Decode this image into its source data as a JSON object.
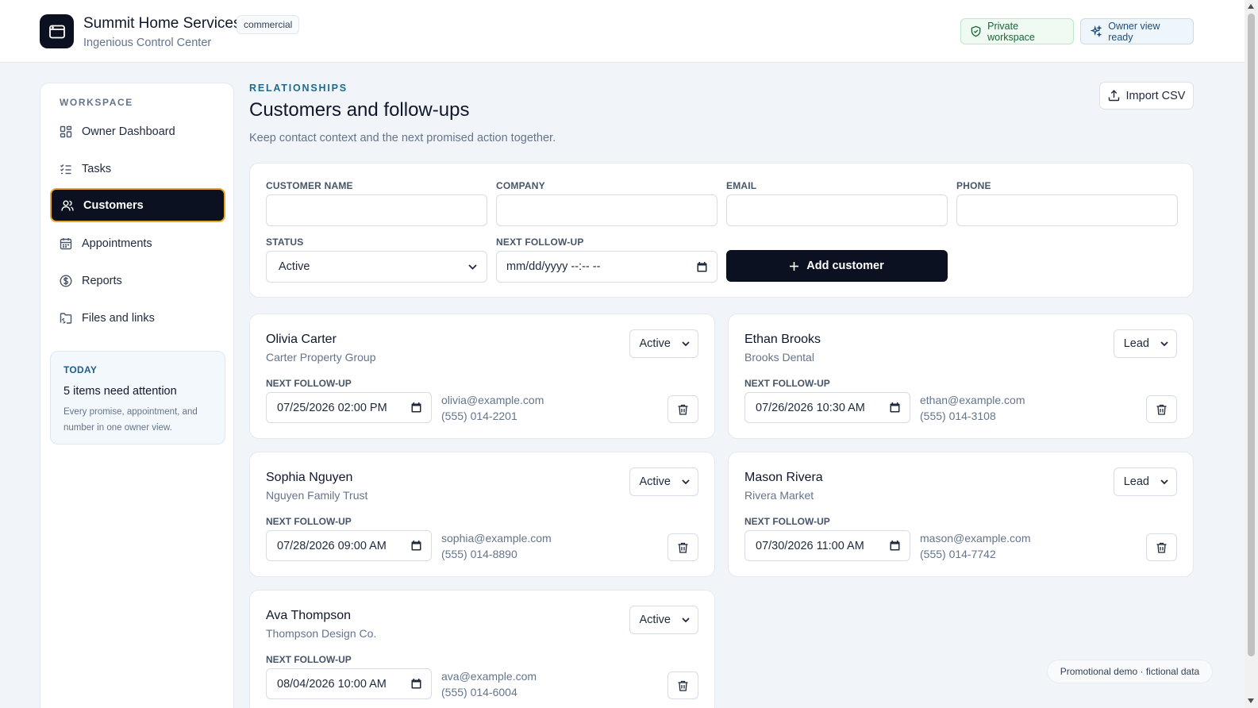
{
  "header": {
    "brand_name": "Summit Home Services",
    "brand_tag": "commercial",
    "brand_sub": "Ingenious Control Center",
    "private_label": "Private workspace",
    "owner_label": "Owner view ready"
  },
  "sidebar": {
    "heading": "WORKSPACE",
    "items": [
      {
        "label": "Owner Dashboard",
        "icon": "dashboard-icon"
      },
      {
        "label": "Tasks",
        "icon": "tasks-icon"
      },
      {
        "label": "Customers",
        "icon": "users-icon",
        "active": true
      },
      {
        "label": "Appointments",
        "icon": "calendar-icon"
      },
      {
        "label": "Reports",
        "icon": "dollar-icon"
      },
      {
        "label": "Files and links",
        "icon": "folder-icon"
      }
    ],
    "today": {
      "label": "TODAY",
      "title": "5 items need attention",
      "desc": "Every promise, appointment, and number in one owner view."
    }
  },
  "main": {
    "eyebrow": "RELATIONSHIPS",
    "title": "Customers and follow-ups",
    "subtitle": "Keep contact context and the next promised action together.",
    "import_label": "Import CSV"
  },
  "form": {
    "name_label": "CUSTOMER NAME",
    "company_label": "COMPANY",
    "email_label": "EMAIL",
    "phone_label": "PHONE",
    "status_label": "STATUS",
    "status_value": "Active",
    "followup_label": "NEXT FOLLOW-UP",
    "followup_placeholder": "mm/dd/yyyy --:-- --",
    "add_label": "Add customer"
  },
  "customers": [
    {
      "name": "Olivia Carter",
      "company": "Carter Property Group",
      "status": "Active",
      "followup_label": "NEXT FOLLOW-UP",
      "followup": "07/25/2026 02:00 PM",
      "email": "olivia@example.com",
      "phone": "(555) 014-2201"
    },
    {
      "name": "Ethan Brooks",
      "company": "Brooks Dental",
      "status": "Lead",
      "followup_label": "NEXT FOLLOW-UP",
      "followup": "07/26/2026 10:30 AM",
      "email": "ethan@example.com",
      "phone": "(555) 014-3108"
    },
    {
      "name": "Sophia Nguyen",
      "company": "Nguyen Family Trust",
      "status": "Active",
      "followup_label": "NEXT FOLLOW-UP",
      "followup": "07/28/2026 09:00 AM",
      "email": "sophia@example.com",
      "phone": "(555) 014-8890"
    },
    {
      "name": "Mason Rivera",
      "company": "Rivera Market",
      "status": "Lead",
      "followup_label": "NEXT FOLLOW-UP",
      "followup": "07/30/2026 11:00 AM",
      "email": "mason@example.com",
      "phone": "(555) 014-7742"
    },
    {
      "name": "Ava Thompson",
      "company": "Thompson Design Co.",
      "status": "Active",
      "followup_label": "NEXT FOLLOW-UP",
      "followup": "08/04/2026 10:00 AM",
      "email": "ava@example.com",
      "phone": "(555) 014-6004"
    }
  ],
  "promo": "Promotional demo · fictional data",
  "colors": {
    "dark": "#0b1120",
    "accent_border": "#e4a92b",
    "eyebrow": "#1f6a92",
    "private_bg": "#effaf3",
    "owner_bg": "#eff6fb"
  }
}
